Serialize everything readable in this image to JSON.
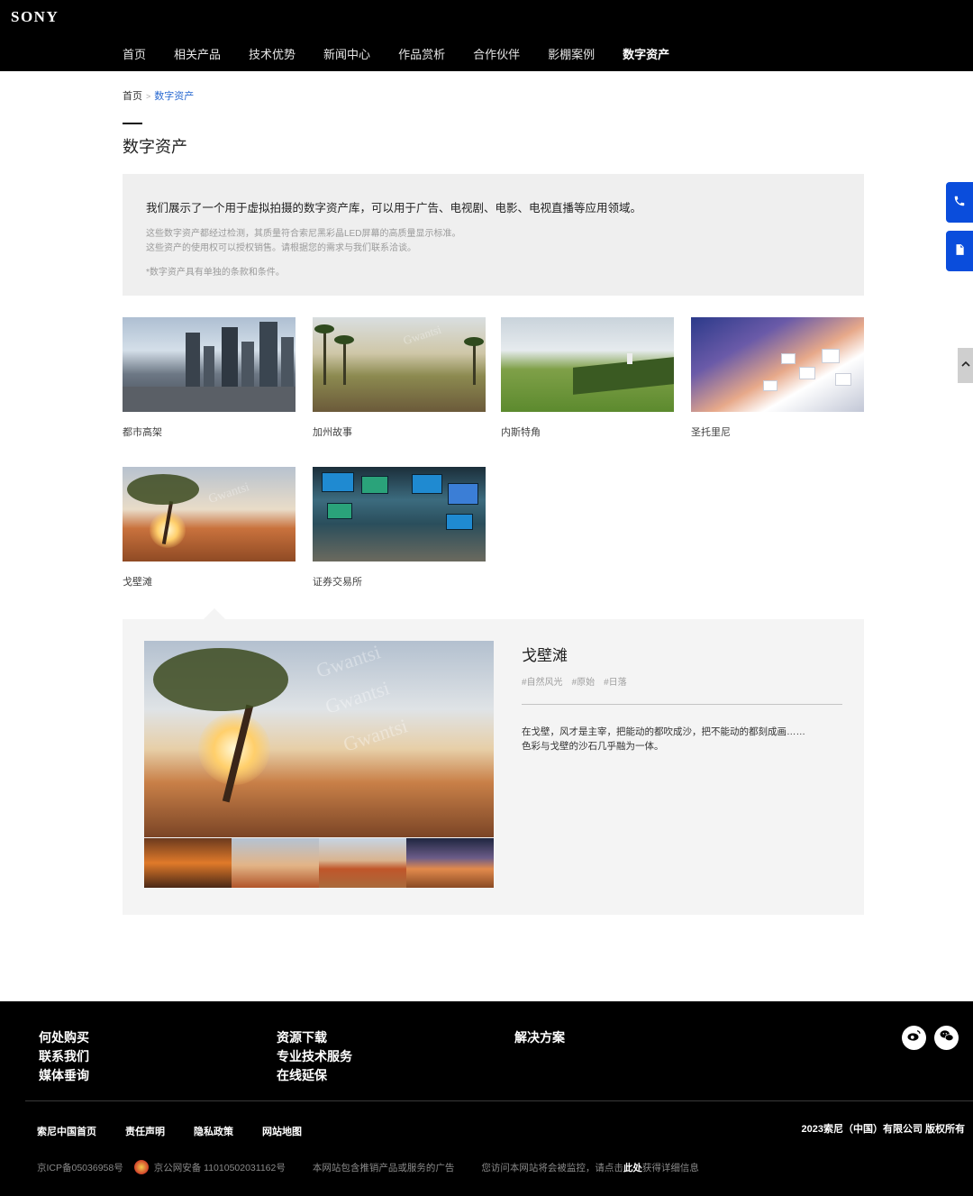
{
  "brand": {
    "logo": "SONY"
  },
  "nav": {
    "items": [
      "首页",
      "相关产品",
      "技术优势",
      "新闻中心",
      "作品赏析",
      "合作伙伴",
      "影棚案例",
      "数字资产"
    ],
    "active": "数字资产"
  },
  "breadcrumb": {
    "home": "首页",
    "separator": ">",
    "current": "数字资产"
  },
  "page": {
    "title": "数字资产"
  },
  "intro": {
    "main": "我们展示了一个用于虚拟拍摄的数字资产库，可以用于广告、电视剧、电影、电视直播等应用领域。",
    "line1": "这些数字资产都经过检测，其质量符合索尼黑彩晶LED屏幕的高质量显示标准。",
    "line2": "这些资产的使用权可以授权销售。请根据您的需求与我们联系洽谈。",
    "note": "*数字资产具有单独的条款和条件。"
  },
  "assets": [
    {
      "label": "都市高架"
    },
    {
      "label": "加州故事"
    },
    {
      "label": "内斯特角"
    },
    {
      "label": "圣托里尼"
    },
    {
      "label": "戈壁滩"
    },
    {
      "label": "证券交易所"
    }
  ],
  "watermark": {
    "text": "Gwantsi"
  },
  "detail": {
    "title": "戈壁滩",
    "tags": [
      "#自然风光",
      "#原始",
      "#日落"
    ],
    "desc_line1": "在戈壁，风才是主宰，把能动的都吹成沙，把不能动的都刻成画……",
    "desc_line2": "色彩与戈壁的沙石几乎融为一体。"
  },
  "side_buttons": {
    "phone_icon": "phone-icon",
    "form_icon": "form-icon",
    "top_icon": "chevron-up-icon"
  },
  "footer": {
    "col1": [
      "何处购买",
      "联系我们",
      "媒体垂询"
    ],
    "col2": [
      "资源下载",
      "专业技术服务",
      "在线延保"
    ],
    "col3": [
      "解决方案"
    ],
    "social": [
      "weibo-icon",
      "wechat-icon"
    ],
    "links": [
      "索尼中国首页",
      "责任声明",
      "隐私政策",
      "网站地图"
    ],
    "copyright": "2023索尼（中国）有限公司 版权所有",
    "icp": "京ICP备05036958号",
    "police": "京公网安备 11010502031162号",
    "ad_note": "本网站包含推销产品或服务的广告",
    "monitor_prefix": "您访问本网站将会被监控，请点击",
    "monitor_link": "此处",
    "monitor_suffix": "获得详细信息"
  },
  "colors": {
    "header_bg": "#000000",
    "accent": "#0a4ddc",
    "breadcrumb_active": "#2a6ad1",
    "panel_bg": "#f4f4f4"
  }
}
